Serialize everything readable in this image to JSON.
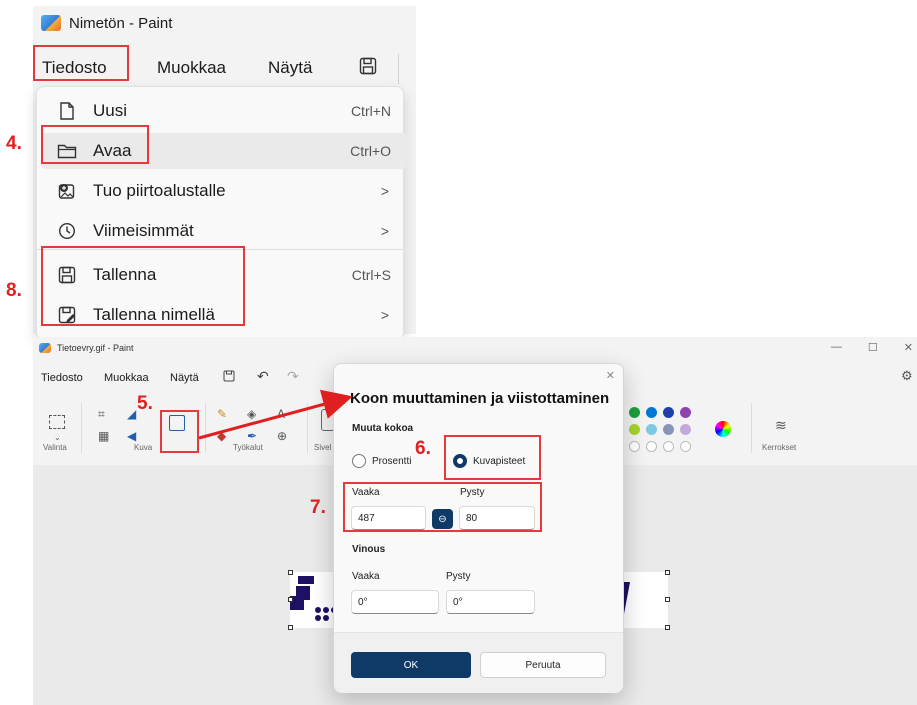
{
  "top": {
    "title": "Nimetön - Paint",
    "menu": [
      "Tiedosto",
      "Muokkaa",
      "Näytä"
    ],
    "dropdown": [
      {
        "label": "Uusi",
        "shortcut": "Ctrl+N",
        "icon": "new-file-icon"
      },
      {
        "label": "Avaa",
        "shortcut": "Ctrl+O",
        "icon": "folder-icon"
      },
      {
        "label": "Tuo piirtoalustalle",
        "chevron": ">",
        "icon": "import-image-icon"
      },
      {
        "label": "Viimeisimmät",
        "chevron": ">",
        "icon": "clock-icon"
      },
      {
        "label": "Tallenna",
        "shortcut": "Ctrl+S",
        "icon": "save-icon"
      },
      {
        "label": "Tallenna nimellä",
        "chevron": ">",
        "icon": "save-as-icon"
      }
    ]
  },
  "bottom": {
    "title": "Tietoevry.gif - Paint",
    "window_controls": [
      "—",
      "☐",
      "✕"
    ],
    "menu": [
      "Tiedosto",
      "Muokkaa",
      "Näytä"
    ],
    "ribbon_groups": [
      "Valinta",
      "Kuva",
      "Työkalut",
      "Sivel",
      "Kerrokset"
    ],
    "palette_colors": [
      "#1a9e3f",
      "#0078d4",
      "#1f3fa8",
      "#8e44ad",
      "#a6d428",
      "#7ec8e3",
      "#8a94b8",
      "#c4a8dc"
    ]
  },
  "dialog": {
    "title": "Koon muuttaminen ja viistottaminen",
    "resize_section": "Muuta kokoa",
    "option_percent": "Prosentti",
    "option_pixels": "Kuvapisteet",
    "horizontal_label": "Vaaka",
    "vertical_label": "Pysty",
    "horizontal_value": "487",
    "vertical_value": "80",
    "skew_section": "Vinous",
    "skew_horizontal_label": "Vaaka",
    "skew_vertical_label": "Pysty",
    "skew_horizontal_value": "0°",
    "skew_vertical_value": "0°",
    "ok": "OK",
    "cancel": "Peruuta",
    "close": "✕"
  },
  "annotations": {
    "step4": "4.",
    "step5": "5.",
    "step6": "6.",
    "step7": "7.",
    "step8": "8.",
    "color": "#e33b3b"
  }
}
